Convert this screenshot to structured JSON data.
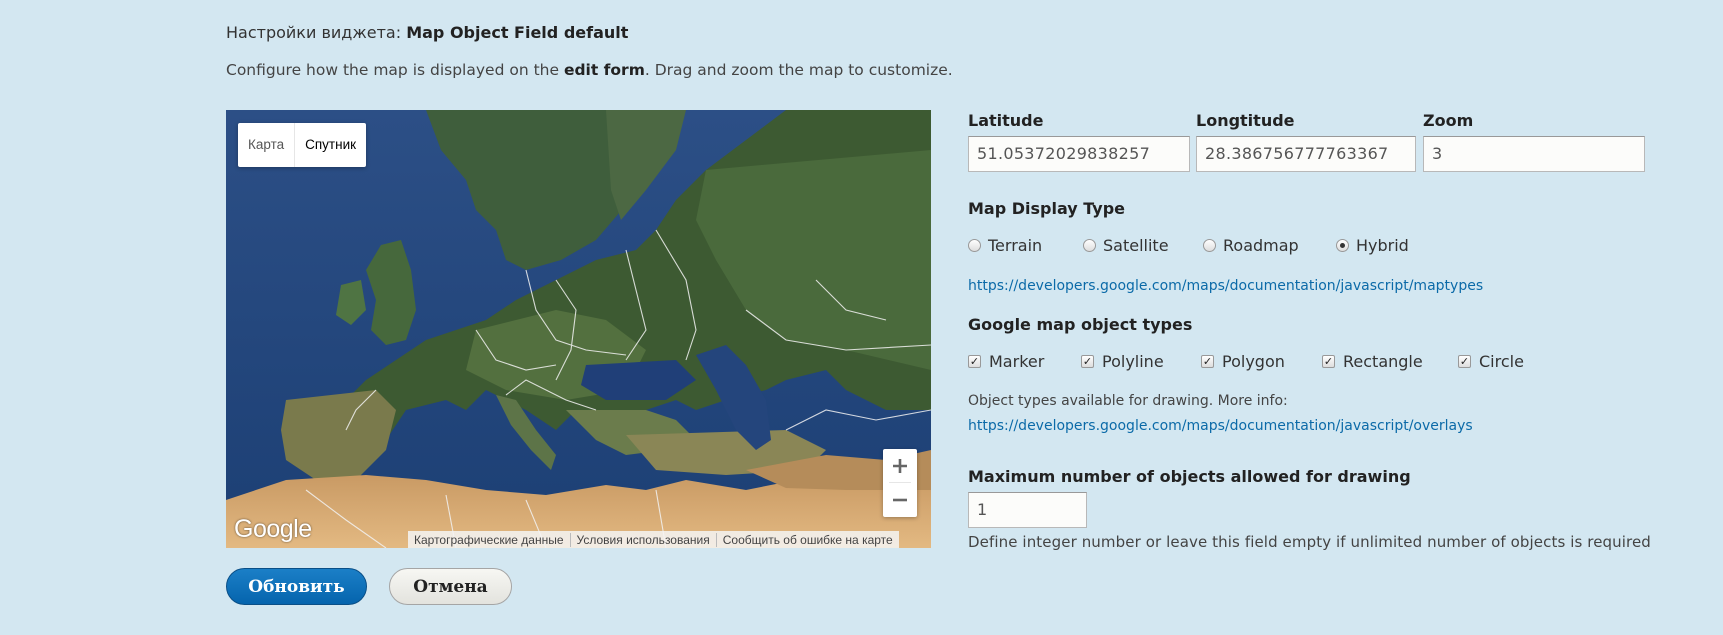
{
  "header": {
    "title_prefix": "Настройки виджета: ",
    "title_name": "Map Object Field default",
    "desc_pre": "Configure how the map is displayed on the ",
    "desc_bold": "edit form",
    "desc_post": ". Drag and zoom the map to customize."
  },
  "map": {
    "type_map": "Карта",
    "type_satellite": "Спутник",
    "selected_type": "Спутник",
    "zoom_in": "+",
    "zoom_out": "−",
    "logo": "Google",
    "attribution": [
      "Картографические данные",
      "Условия использования",
      "Сообщить об ошибке на карте"
    ]
  },
  "fields": {
    "latitude_label": "Latitude",
    "latitude_value": "51.05372029838257",
    "longitude_label": "Longtitude",
    "longitude_value": "28.386756777763367",
    "zoom_label": "Zoom",
    "zoom_value": "3"
  },
  "display_type": {
    "label": "Map Display Type",
    "options": [
      "Terrain",
      "Satellite",
      "Roadmap",
      "Hybrid"
    ],
    "selected": "Hybrid",
    "link": "https://developers.google.com/maps/documentation/javascript/maptypes"
  },
  "object_types": {
    "label": "Google map object types",
    "options": [
      "Marker",
      "Polyline",
      "Polygon",
      "Rectangle",
      "Circle"
    ],
    "checked": [
      true,
      true,
      true,
      true,
      true
    ],
    "note": "Object types available for drawing. More info:",
    "link": "https://developers.google.com/maps/documentation/javascript/overlays"
  },
  "max_objects": {
    "label": "Maximum number of objects allowed for drawing",
    "value": "1",
    "help": "Define integer number or leave this field empty if unlimited number of objects is required"
  },
  "actions": {
    "update": "Обновить",
    "cancel": "Отмена"
  }
}
